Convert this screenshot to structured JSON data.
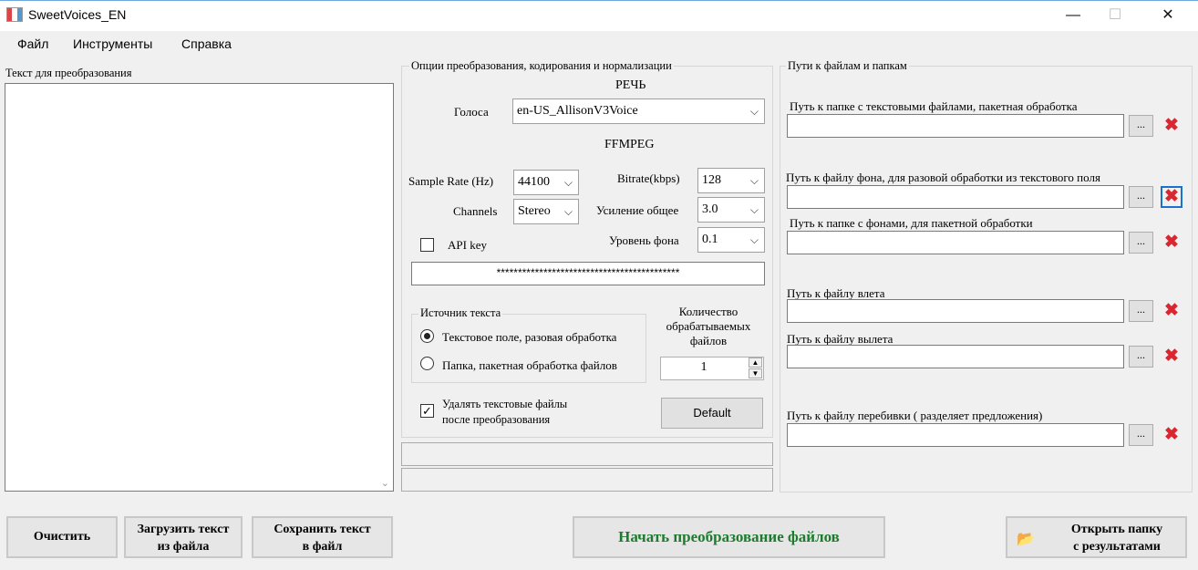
{
  "window": {
    "title": "SweetVoices_EN",
    "minimize": "—",
    "maximize": "☐",
    "close": "✕"
  },
  "menu": [
    "Файл",
    "Инструменты",
    "Справка"
  ],
  "text_panel": {
    "label": "Текст для преобразования",
    "value": ""
  },
  "options": {
    "group_label": "Опции преобразования, кодирования и нормализации",
    "speech_header": "РЕЧЬ",
    "voices_label": "Голоса",
    "voice_value": "en-US_AllisonV3Voice",
    "ffmpeg_header": "FFMPEG",
    "sample_rate_label": "Sample Rate (Hz)",
    "sample_rate_value": "44100",
    "channels_label": "Channels",
    "channels_value": "Stereo",
    "bitrate_label": "Bitrate(kbps)",
    "bitrate_value": "128",
    "gain_label": "Усиление общее",
    "gain_value": "3.0",
    "bg_level_label": "Уровень фона",
    "bg_level_value": "0.1",
    "api_key_label": "API key",
    "api_key_checked": false,
    "api_key_value": "*******************************************",
    "source_group_label": "Источник текста",
    "source_option1": "Текстовое поле, разовая обработка",
    "source_option2": "Папка, пакетная обработка файлов",
    "selected_source": 1,
    "count_label": "Количество обрабатываемых файлов",
    "count_value": "1",
    "delete_files_label": "Удалять текстовые файлы после преобразования",
    "delete_files_checked": true,
    "default_button": "Default",
    "status1": "",
    "status2": ""
  },
  "paths": {
    "group_label": "Пути к файлам и папкам",
    "items": [
      {
        "label": "Путь к папке с текстовыми файлами, пакетная обработка",
        "value": ""
      },
      {
        "label": "Путь к файлу фона, для разовой обработки из текстового поля",
        "value": ""
      },
      {
        "label": "Путь к папке с фонами, для пакетной обработки",
        "value": ""
      },
      {
        "label": "Путь к файлу влета",
        "value": ""
      },
      {
        "label": "Путь к файлу вылета",
        "value": ""
      },
      {
        "label": "Путь к файлу перебивки ( разделяет предложения)",
        "value": ""
      }
    ],
    "browse_label": "...",
    "clear_label": "✖"
  },
  "buttons": {
    "clear": "Очистить",
    "load_text_line1": "Загрузить текст",
    "load_text_line2": "из файла",
    "save_text_line1": "Сохранить текст",
    "save_text_line2": "в файл",
    "start": "Начать преобразование файлов",
    "open_folder_line1": "Открыть папку",
    "open_folder_line2": "с результатами"
  },
  "colors": {
    "start_text": "#1e7a2e",
    "clear_x": "#d9262f",
    "focus_border": "#1a73c9"
  },
  "icons": {
    "app": "app-icon",
    "folder": "folder-open-icon"
  }
}
